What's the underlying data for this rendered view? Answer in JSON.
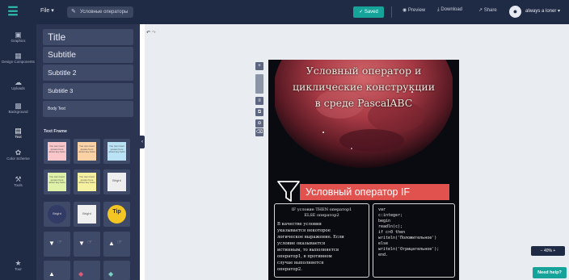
{
  "topbar": {
    "file_label": "File",
    "doc_title": "Условные операторы",
    "saved_label": "Saved",
    "preview_label": "Preview",
    "download_label": "Download",
    "share_label": "Share",
    "user_name": "always a loner"
  },
  "leftnav": [
    {
      "label": "Graphics",
      "icon": "image-icon"
    },
    {
      "label": "Design Components",
      "icon": "grid-icon"
    },
    {
      "label": "Uploads",
      "icon": "cloud-upload-icon"
    },
    {
      "label": "Background",
      "icon": "background-icon"
    },
    {
      "label": "Text",
      "icon": "text-icon"
    },
    {
      "label": "Color Scheme",
      "icon": "palette-icon"
    },
    {
      "label": "Tools",
      "icon": "toolbox-icon"
    },
    {
      "label": "Tour",
      "icon": "trophy-icon"
    }
  ],
  "panel": {
    "text_buttons": [
      "Title",
      "Subtitle",
      "Subtitle 2",
      "Subtitle 3",
      "Body Text"
    ],
    "section_label": "Text Frame",
    "note_text": "You can insert quotes here about key facts",
    "tile_labels": [
      "Bright",
      "Bright",
      "Bright",
      "Tip"
    ]
  },
  "canvas": {
    "title_lines": [
      "Условный оператор и",
      "циклические конструкции",
      "в среде PascalABC"
    ],
    "banner": "Условный оператор IF",
    "syntax_lines": [
      "IF условие THEN оператор1",
      "ELSE оператор2"
    ],
    "description_lines": [
      "В качестве условия",
      "указывается некоторое",
      "логическое выражение. Если",
      "условие оказывается",
      "истинным, то выполняется",
      "оператор1, в противном",
      "случае выполняется",
      "оператор2."
    ],
    "code_lines": [
      "var",
      "c:integer;",
      "begin",
      "readln(c);",
      "if c>0 then",
      "writeln('Положительное')",
      "else",
      "writeln('Отрицательное');",
      "end."
    ]
  },
  "footer": {
    "zoom_label": "40%",
    "help_label": "Need help?"
  },
  "colors": {
    "sidebar": "#1f2a44",
    "panel": "#2b3552",
    "accent": "#16a39a",
    "banner": "#e1524f"
  }
}
